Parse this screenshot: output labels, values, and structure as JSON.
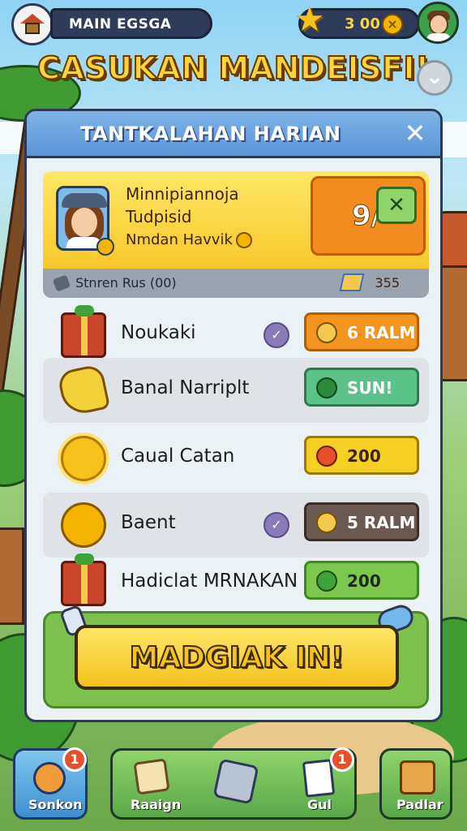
{
  "top": {
    "player_name": "MAIN EGSGA",
    "stars": "3 00"
  },
  "title": "CASUKAN MANDEISFI!",
  "panel": {
    "title": "TANTKALAHAN HARIAN",
    "profile": {
      "line1": "Minnipiannoja",
      "line2": "Tudpisid",
      "line3": "Nmdan Havvik",
      "score": "9/"
    },
    "status": {
      "text": "Stnren Rus (00)",
      "value": "355"
    },
    "rows": [
      {
        "label": "Noukaki",
        "reward": "6 RALM",
        "reward_color": "#f3951f",
        "checked": true,
        "icon": "gift-icon"
      },
      {
        "label": "Banal Narriplt",
        "reward": "SUN!",
        "reward_color": "#5bc28a",
        "checked": false,
        "icon": "hand-icon"
      },
      {
        "label": "Caual Catan",
        "reward": "200",
        "reward_color": "#f5cf22",
        "checked": false,
        "icon": "sun-icon"
      },
      {
        "label": "Baent",
        "reward": "5 RALM",
        "reward_color": "#6a5a52",
        "checked": true,
        "icon": "coin-icon"
      },
      {
        "label": "Hadiclat MRNAKAN",
        "reward": "200",
        "reward_color": "#7cc84e",
        "checked": false,
        "icon": "gift-icon"
      }
    ],
    "cta": "MADGIAK IN!"
  },
  "nav": {
    "left_label": "Sonkon",
    "left_badge": "1",
    "mid_label_1": "Raaign",
    "mid_label_3": "Gul",
    "mid_badge": "1",
    "right_label": "Padlar"
  }
}
